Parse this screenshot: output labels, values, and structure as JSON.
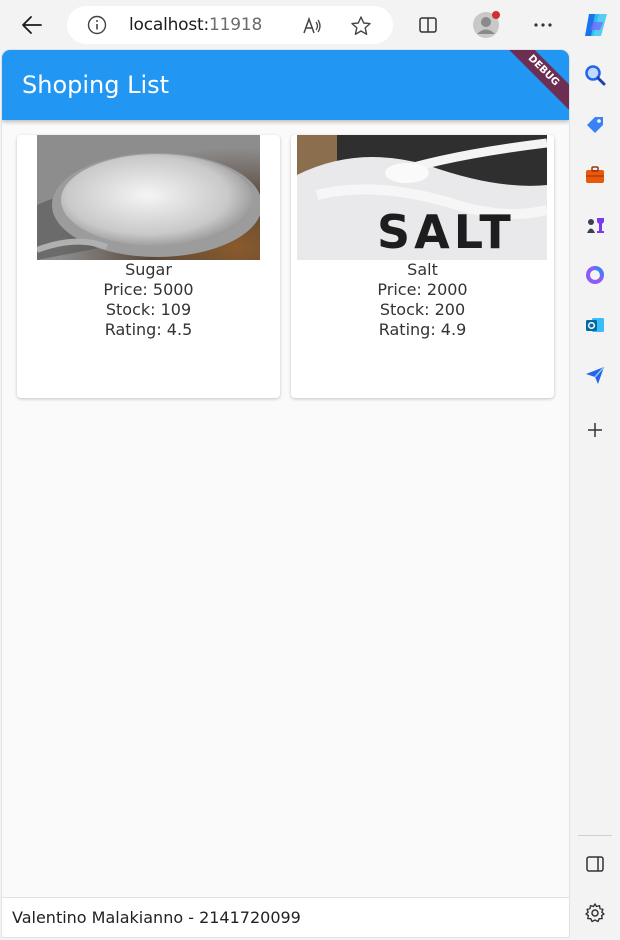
{
  "browser": {
    "url_host": "localhost:",
    "url_port": "11918",
    "back_icon": "back-arrow-icon",
    "info_icon": "info-icon",
    "read_aloud_icon": "read-aloud-icon",
    "favorite_icon": "star-icon",
    "split_icon": "split-screen-icon",
    "profile_icon": "profile-avatar-icon",
    "menu_icon": "more-icon",
    "copilot_icon": "copilot-icon"
  },
  "app": {
    "title": "Shoping List",
    "debug_label": "DEBUG",
    "accent_color": "#2196f3",
    "products": [
      {
        "name": "Sugar",
        "price": "Price: 5000",
        "stock": "Stock: 109",
        "rating": "Rating: 4.5",
        "image": "sugar-spoon-photo"
      },
      {
        "name": "Salt",
        "price": "Price: 2000",
        "stock": "Stock: 200",
        "rating": "Rating: 4.9",
        "image": "salt-spoon-photo"
      }
    ],
    "footer_text": "Valentino Malakianno - 2141720099"
  },
  "sidebar": {
    "items": [
      "search-icon",
      "tag-icon",
      "briefcase-icon",
      "chess-icon",
      "copilot-circle-icon",
      "outlook-icon",
      "send-icon",
      "add-icon"
    ],
    "bottom": [
      "sidebar-toggle-icon",
      "settings-icon"
    ]
  }
}
